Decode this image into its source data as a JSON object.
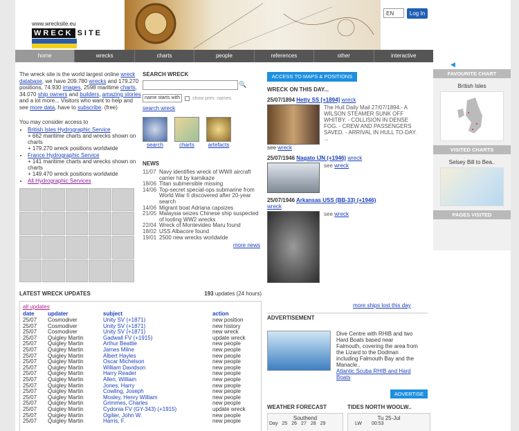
{
  "header": {
    "url": "www.wrecksite.eu",
    "logo_wreck": "WRECK",
    "logo_site": "SITE",
    "lang": "EN",
    "login": "Log In"
  },
  "nav": [
    "home",
    "wrecks",
    "charts",
    "people",
    "references",
    "other",
    "interactive"
  ],
  "intro": {
    "text_1": "The wreck site is the world largest online ",
    "link_db": "wreck database",
    "text_2": ", we have 209.780 ",
    "link_wrecks": "wrecks",
    "text_3": " and 179.270 positions, 74.930 ",
    "link_images": "images",
    "text_4": ", 2598 maritime ",
    "link_charts": "charts",
    "text_5": ", 34.070 ",
    "link_owners": "ship owners",
    "text_6": " and ",
    "link_builders": "builders",
    "text_7": ", ",
    "link_stories": "amazing stories",
    "text_8": " and a lot more... Visitors who want to help and see ",
    "link_more": "more data",
    "text_9": ", have to ",
    "link_subscribe": "subscribe",
    "text_10": ". (free)"
  },
  "consider": {
    "title": "You may consider access to",
    "items": [
      {
        "link": "British Isles Hydrographic Service",
        "l1": "+ 662 maritime charts and wrecks shown on charts",
        "l2": "+ 179.270 wreck positions worldwide"
      },
      {
        "link": "France Hydrographic Service",
        "l1": "+ 141 maritime charts and wrecks shown on charts",
        "l2": "+ 149.470 wreck positions worldwide"
      }
    ],
    "all": "All Hydrographic Services"
  },
  "search": {
    "title": "SEARCH WRECK",
    "mode": "name starts with",
    "prev": "show prev. names",
    "link": "search wreck",
    "thumbs": [
      "search",
      "charts",
      "artefacts"
    ]
  },
  "news": {
    "title": "NEWS",
    "items": [
      {
        "d": "11/07",
        "t": "Navy identifies wreck of WWII aircraft carrier hit by kamikaze"
      },
      {
        "d": "18/06",
        "t": "Titan submersible missing"
      },
      {
        "d": "14/06",
        "t": "Top-secret special-ops submarine from World War II discovered after 20-year search"
      },
      {
        "d": "14/06",
        "t": "Migrant boat Adriana capsizes"
      },
      {
        "d": "21/05",
        "t": "Malaysia seizes Chinese ship suspected of looting WW2 wrecks"
      },
      {
        "d": "22/04",
        "t": "Wreck of Montevideo Maru found"
      },
      {
        "d": "18/02",
        "t": "USS Albacore found"
      },
      {
        "d": "19/01",
        "t": "2500 new wrecks worldwide"
      }
    ],
    "more": "more news"
  },
  "maps_button": "ACCESS TO MAPS & POSITIONS",
  "onthisday": {
    "title": "WRECK ON THIS DAY...",
    "items": [
      {
        "date": "25/07/1894",
        "name": "Hetty SS [+1894]",
        "wreck": "wreck",
        "text": "The Hull Daily Mail 27/07/1894:- A WILSON STEAMER SUNK OFF WHITBY. - COLLISION IN DENSE FOG. - CREW AND PASSENGERS SAVED. - ARRIVAL IN HULL TO-DAY. ...",
        "see": "see",
        "seelink": "wreck"
      },
      {
        "date": "25/07/1946",
        "name": "Nagato IJN (+1946)",
        "wreck": "wreck",
        "see": "see",
        "seelink": "wreck"
      },
      {
        "date": "25/07/1946",
        "name": "Arkansas USS (BB-33) (+1946)",
        "wreck": "wreck",
        "see": "see",
        "seelink": "wreck"
      }
    ],
    "more": "more ships lost this day"
  },
  "advert": {
    "title": "ADVERTISEMENT",
    "text": "Dive Centre with RHIB and two Hard Boats based near Falmouth, covering the area from the Lizard to the Dodman including Falmouth Bay and the Manacle..",
    "link": "Atlantic Scuba RHIB and Hard Boats",
    "button": "ADVERTISE"
  },
  "weather": {
    "title": "WEATHER FORECAST",
    "place": "Southend",
    "day": "Day",
    "dates": [
      "25",
      "26",
      "27",
      "28",
      "29"
    ]
  },
  "tides": {
    "title": "TIDES NORTH WOOLW..",
    "date": "Tu 25-Jul",
    "lw": "LW",
    "time": "00:53"
  },
  "updates": {
    "title": "LATEST WRECK UPDATES",
    "count": "193",
    "count_label": "updates (24 hours)",
    "all": "all updates",
    "cols": [
      "date",
      "updater",
      "subject",
      "action"
    ],
    "rows": [
      [
        "25/07",
        "Cosmodiver",
        "Unity SV (+1871)",
        "new position"
      ],
      [
        "25/07",
        "Cosmodiver",
        "Unity SV (+1871)",
        "new history"
      ],
      [
        "25/07",
        "Cosmodiver",
        "Unity SV (+1871)",
        "new wreck"
      ],
      [
        "25/07",
        "Quigley Martin",
        "Gadwall FV (+1915)",
        "update wreck"
      ],
      [
        "25/07",
        "Quigley Martin",
        "Arthur Beattie",
        "new people"
      ],
      [
        "25/07",
        "Quigley Martin",
        "James Milne",
        "new people"
      ],
      [
        "25/07",
        "Quigley Martin",
        "Albert Hayles",
        "new people"
      ],
      [
        "25/07",
        "Quigley Martin",
        "Oscar Michelson",
        "new people"
      ],
      [
        "25/07",
        "Quigley Martin",
        "William Davidson",
        "new people"
      ],
      [
        "25/07",
        "Quigley Martin",
        "Harry Reader",
        "new people"
      ],
      [
        "25/07",
        "Quigley Martin",
        "Allen, William",
        "new people"
      ],
      [
        "25/07",
        "Quigley Martin",
        "Jones, Harry",
        "new people"
      ],
      [
        "25/07",
        "Quigley Martin",
        "Cowling, Joseph",
        "new people"
      ],
      [
        "25/07",
        "Quigley Martin",
        "Mosley, Henry William",
        "new people"
      ],
      [
        "25/07",
        "Quigley Martin",
        "Grimmes, Charles",
        "new people"
      ],
      [
        "25/07",
        "Quigley Martin",
        "Cydonia FV (GY-343) (+1915)",
        "update wreck"
      ],
      [
        "25/07",
        "Quigley Martin",
        "Ogilier, John W.",
        "new people"
      ],
      [
        "25/07",
        "Quigley Martin",
        "Harris, F.",
        "new people"
      ]
    ]
  },
  "right": {
    "fav_title": "FAVOURITE CHART",
    "fav_caption": "British Isles",
    "visited_title": "VISITED CHARTS",
    "visited_caption": "Selsey Bill to Bea..",
    "pages_title": "PAGES VISITED"
  }
}
